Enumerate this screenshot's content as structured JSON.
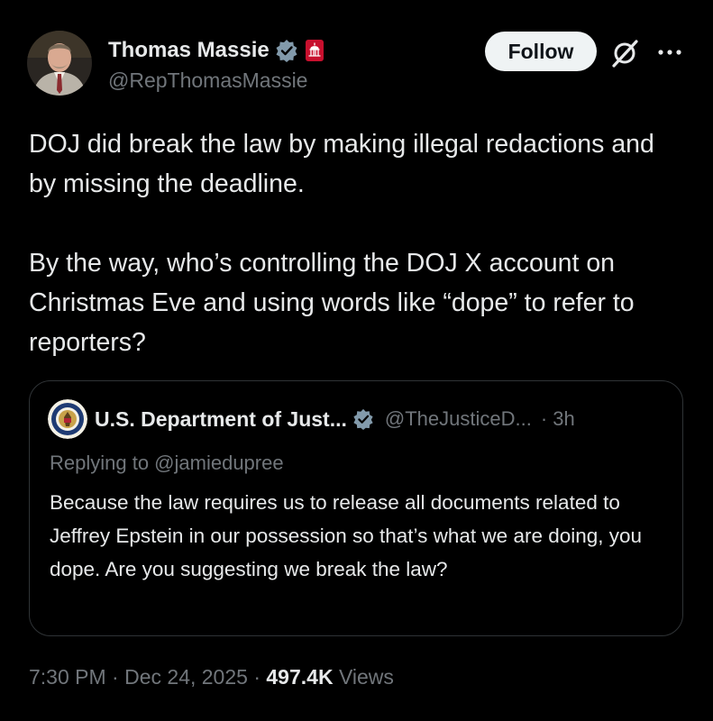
{
  "author": {
    "name": "Thomas Massie",
    "handle": "@RepThomasMassie",
    "verified_color": "#829aab",
    "gov_badge_color": "#c8102e"
  },
  "header": {
    "follow_label": "Follow",
    "grok_icon": "grok-icon",
    "more_icon": "more-icon"
  },
  "tweet": {
    "paragraphs": [
      "DOJ did break the law by making illegal redactions and by missing the deadline.",
      "By the way, who’s controlling the DOJ X account on Christmas Eve and using words like “dope” to refer to reporters?"
    ]
  },
  "quote": {
    "name": "U.S. Department of Just...",
    "handle": "@TheJusticeD...",
    "time": "· 3h",
    "reply_to": "Replying to @jamiedupree",
    "text": "Because the law requires us to release all documents related to Jeffrey Epstein in our possession so that’s what we are doing, you dope. Are you suggesting we break the law?"
  },
  "meta": {
    "time": "7:30 PM",
    "sep1": " · ",
    "date": "Dec 24, 2025",
    "sep2": " · ",
    "views_count": "497.4K",
    "views_label": " Views"
  },
  "colors": {
    "background": "#000000",
    "text_primary": "#e7e9ea",
    "text_secondary": "#71767b",
    "border": "#2f3336",
    "follow_bg": "#eff3f4"
  }
}
